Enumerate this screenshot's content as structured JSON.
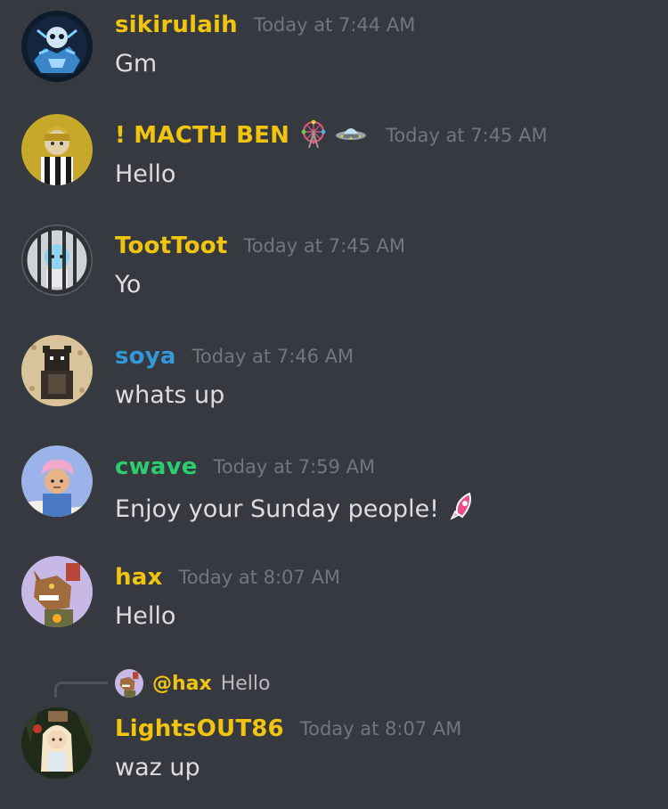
{
  "colors": {
    "background": "#36393f",
    "timestamp": "#72767d",
    "text": "#dcddde",
    "gold": "#f1c40f",
    "blue": "#3498db",
    "green": "#2ecc71"
  },
  "messages": [
    {
      "username": "sikirulaih",
      "timestamp": "Today at 7:44 AM",
      "text": "Gm",
      "name_color": "#f1c40f",
      "avatar_icon": "blue-robot-avatar"
    },
    {
      "username": "! MACTH BEN",
      "timestamp": "Today at 7:45 AM",
      "text": "Hello",
      "name_color": "#f1c40f",
      "avatar_icon": "gold-helmet-avatar",
      "badges": [
        "ferris-wheel-emoji",
        "flying-saucer-emoji"
      ]
    },
    {
      "username": "TootToot",
      "timestamp": "Today at 7:45 AM",
      "text": "Yo",
      "name_color": "#f1c40f",
      "avatar_icon": "jail-ape-avatar"
    },
    {
      "username": "soya",
      "timestamp": "Today at 7:46 AM",
      "text": "whats up",
      "name_color": "#3498db",
      "avatar_icon": "pixel-bear-avatar"
    },
    {
      "username": "cwave",
      "timestamp": "Today at 7:59 AM",
      "text": "Enjoy your Sunday people!",
      "name_color": "#2ecc71",
      "avatar_icon": "pink-hair-avatar",
      "trailing_emoji": "rocket-emoji"
    },
    {
      "username": "hax",
      "timestamp": "Today at 8:07 AM",
      "text": "Hello",
      "name_color": "#f1c40f",
      "avatar_icon": "pixel-wolf-avatar"
    }
  ],
  "reply_message": {
    "reply_to": {
      "username": "@hax",
      "text": "Hello"
    },
    "username": "LightsOUT86",
    "timestamp": "Today at 8:07 AM",
    "text": "waz up",
    "name_color": "#f1c40f",
    "avatar_icon": "forest-girl-avatar"
  }
}
